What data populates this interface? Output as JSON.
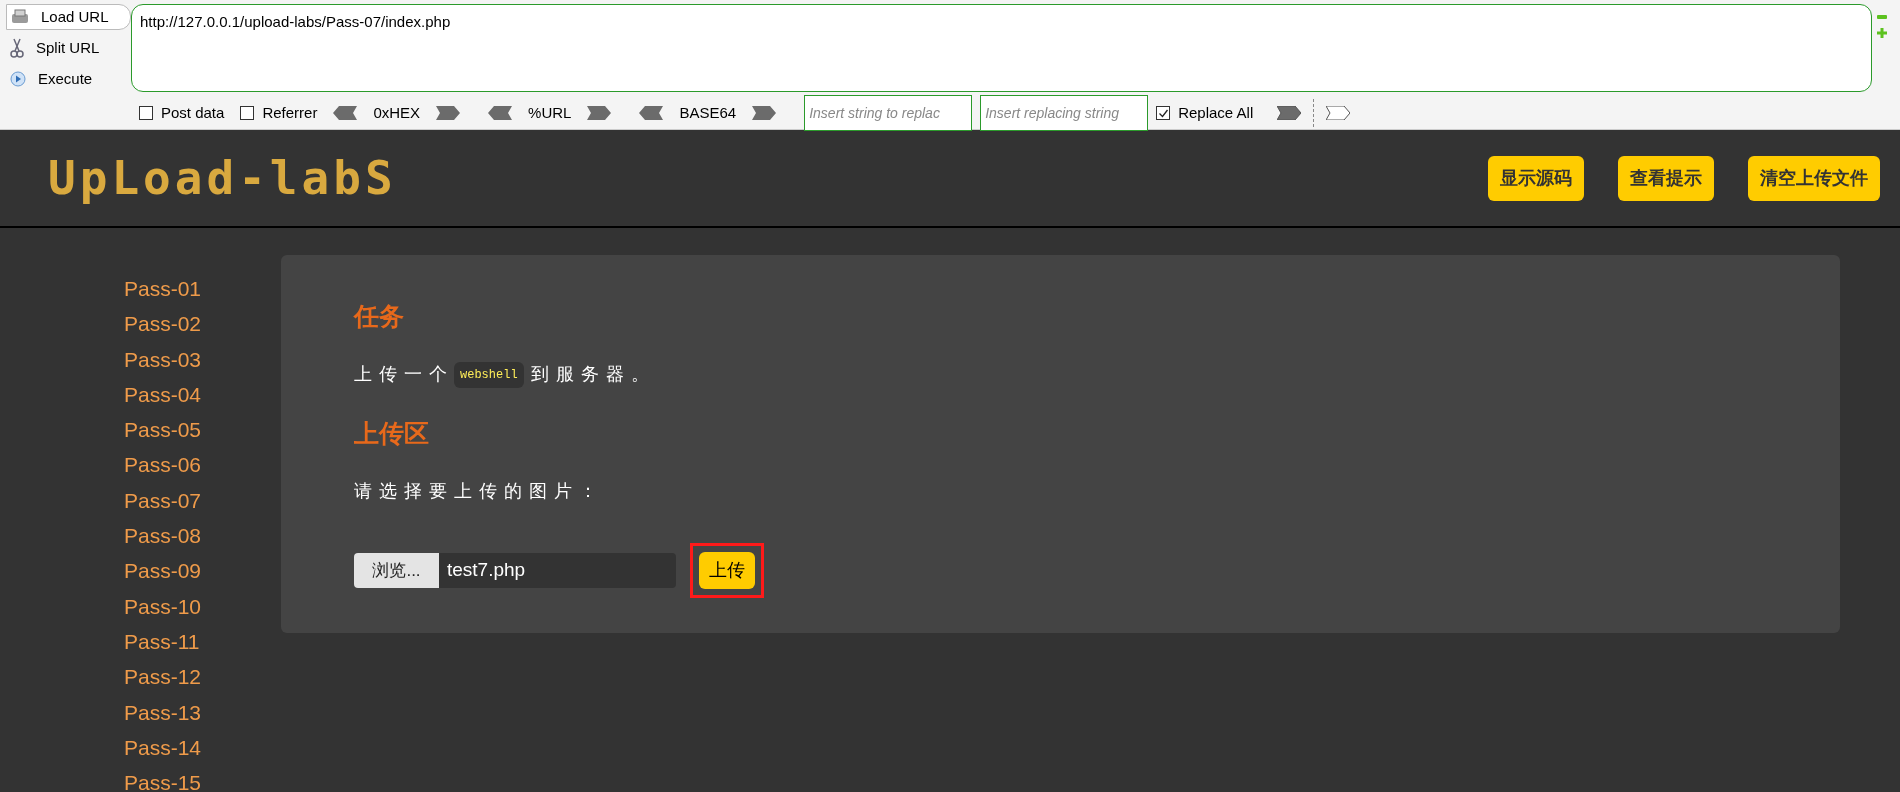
{
  "toolbar": {
    "actions": [
      {
        "kind": "load",
        "label": "Load URL",
        "selected": true
      },
      {
        "kind": "split",
        "label": "Split URL",
        "selected": false
      },
      {
        "kind": "execute",
        "label": "Execute",
        "selected": false
      }
    ],
    "url": "http://127.0.0.1/upload-labs/Pass-07/index.php",
    "options": [
      {
        "kind": "checkbox",
        "label": "Post data",
        "checked": false
      },
      {
        "kind": "checkbox",
        "label": "Referrer",
        "checked": false
      },
      {
        "kind": "encoder",
        "label": "0xHEX"
      },
      {
        "kind": "encoder",
        "label": "%URL"
      },
      {
        "kind": "encoder",
        "label": "BASE64"
      },
      {
        "kind": "field",
        "placeholder": "Insert string to replac"
      },
      {
        "kind": "field",
        "placeholder": "Insert replacing string"
      },
      {
        "kind": "checkbox",
        "label": "Replace All",
        "checked": true
      },
      {
        "kind": "arrow",
        "filled": true
      },
      {
        "kind": "separator"
      },
      {
        "kind": "arrow",
        "filled": false
      }
    ]
  },
  "header": {
    "logo": "UpLoad-labS",
    "buttons": [
      "显示源码",
      "查看提示",
      "清空上传文件"
    ]
  },
  "sidebar": {
    "items": [
      "Pass-01",
      "Pass-02",
      "Pass-03",
      "Pass-04",
      "Pass-05",
      "Pass-06",
      "Pass-07",
      "Pass-08",
      "Pass-09",
      "Pass-10",
      "Pass-11",
      "Pass-12",
      "Pass-13",
      "Pass-14",
      "Pass-15"
    ]
  },
  "content": {
    "task_title": "任务",
    "task_before": "上传一个",
    "task_code": "webshell",
    "task_after": "到服务器。",
    "upload_title": "上传区",
    "upload_label": "请选择要上传的图片：",
    "browse": "浏览...",
    "file_name": "test7.php",
    "submit": "上传",
    "submit_highlighted": true
  }
}
